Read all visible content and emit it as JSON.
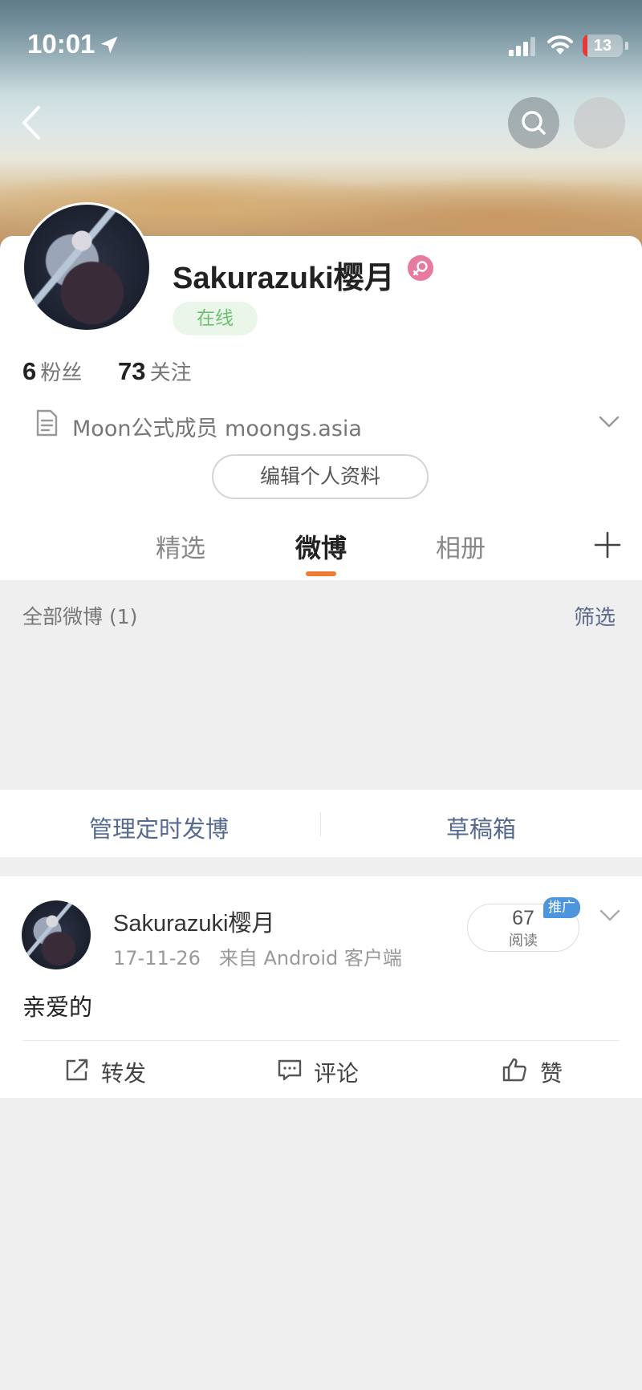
{
  "status_bar": {
    "time": "10:01",
    "battery": "13"
  },
  "profile": {
    "name": "Sakurazuki樱月",
    "online": "在线",
    "followers_count": "6",
    "followers_label": "粉丝",
    "following_count": "73",
    "following_label": "关注",
    "bio": "Moon公式成员 moongs.asia",
    "edit_button": "编辑个人资料"
  },
  "tabs": [
    {
      "label": "精选"
    },
    {
      "label": "微博",
      "selected": true
    },
    {
      "label": "相册"
    }
  ],
  "feed": {
    "all_label": "全部微博 (1)",
    "filter_label": "筛选",
    "manage_scheduled": "管理定时发博",
    "drafts": "草稿箱"
  },
  "post": {
    "author": "Sakurazuki樱月",
    "meta": "17-11-26   来自 Android 客户端",
    "read_count": "67",
    "read_label": "阅读",
    "promo_badge": "推广",
    "text": "亲爱的",
    "actions": {
      "repost": "转发",
      "comment": "评论",
      "like": "赞"
    }
  },
  "colors": {
    "accent": "#ef7b2e",
    "link": "#556a90",
    "online": "#6fbf73",
    "gender": "#e8799f",
    "promo": "#4d95dd"
  },
  "icons": [
    "location-arrow-icon",
    "signal-icon",
    "wifi-icon",
    "back-icon",
    "search-icon",
    "more-icon",
    "female-icon",
    "document-icon",
    "chevron-down-icon",
    "plus-icon",
    "repost-icon",
    "comment-icon",
    "like-icon"
  ]
}
